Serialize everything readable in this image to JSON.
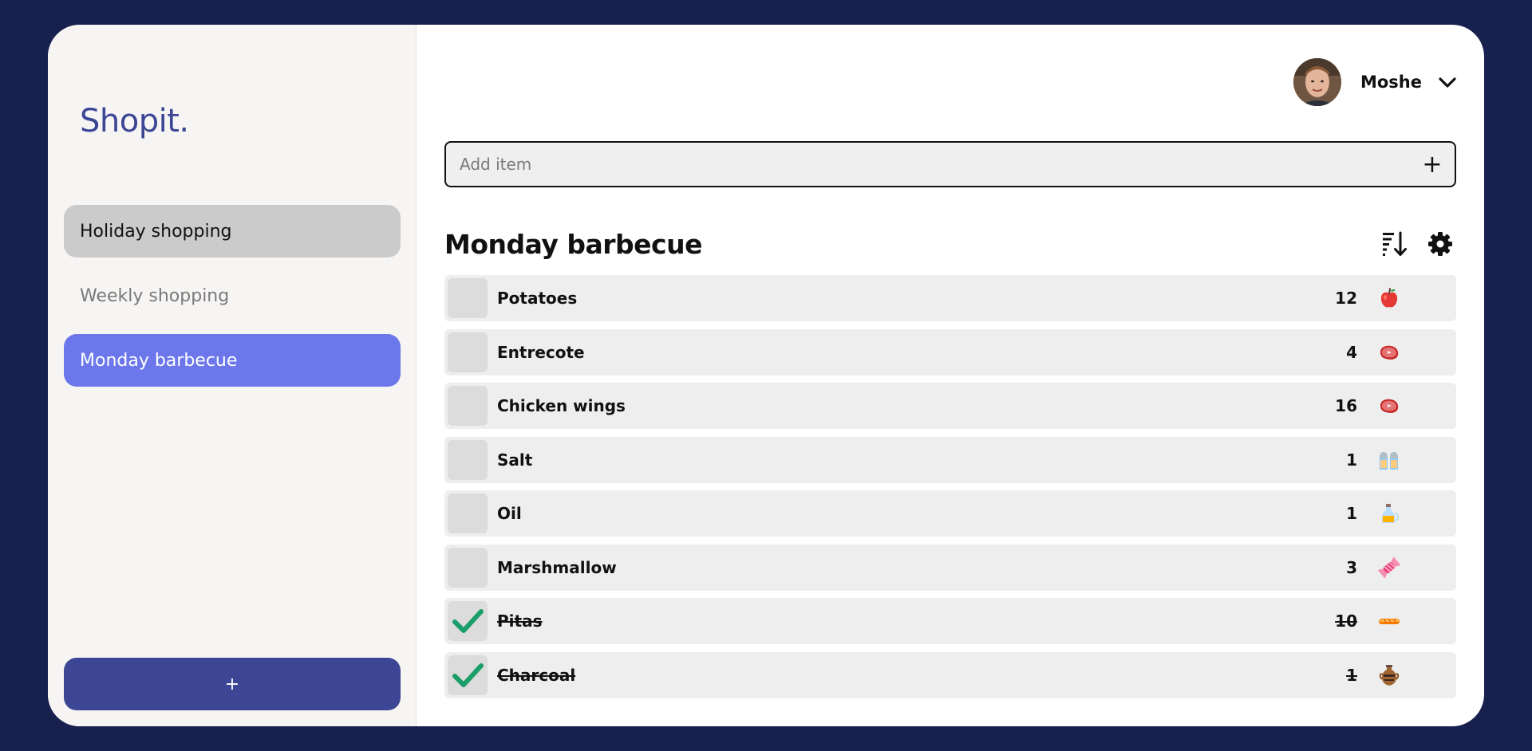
{
  "app": {
    "logo": "Shopit."
  },
  "sidebar": {
    "lists": [
      {
        "label": "Holiday shopping"
      },
      {
        "label": "Weekly shopping"
      },
      {
        "label": "Monday barbecue"
      }
    ],
    "add_label": "+"
  },
  "user": {
    "name": "Moshe"
  },
  "add_item": {
    "placeholder": "Add item",
    "value": "",
    "button_label": "+"
  },
  "list": {
    "title": "Monday barbecue",
    "items": [
      {
        "name": "Potatoes",
        "qty": "12",
        "icon": "apple-icon",
        "checked": false
      },
      {
        "name": "Entrecote",
        "qty": "4",
        "icon": "steak-icon",
        "checked": false
      },
      {
        "name": "Chicken wings",
        "qty": "16",
        "icon": "steak-icon",
        "checked": false
      },
      {
        "name": "Salt",
        "qty": "1",
        "icon": "salt-shaker-icon",
        "checked": false
      },
      {
        "name": "Oil",
        "qty": "1",
        "icon": "oil-bottle-icon",
        "checked": false
      },
      {
        "name": "Marshmallow",
        "qty": "3",
        "icon": "candy-icon",
        "checked": false
      },
      {
        "name": "Pitas",
        "qty": "10",
        "icon": "bread-icon",
        "checked": true
      },
      {
        "name": "Charcoal",
        "qty": "1",
        "icon": "amphora-icon",
        "checked": true
      }
    ]
  },
  "colors": {
    "background": "#18204d",
    "brand": "#3d4694",
    "active_list": "#6b77ea",
    "check": "#1a9e6a"
  }
}
